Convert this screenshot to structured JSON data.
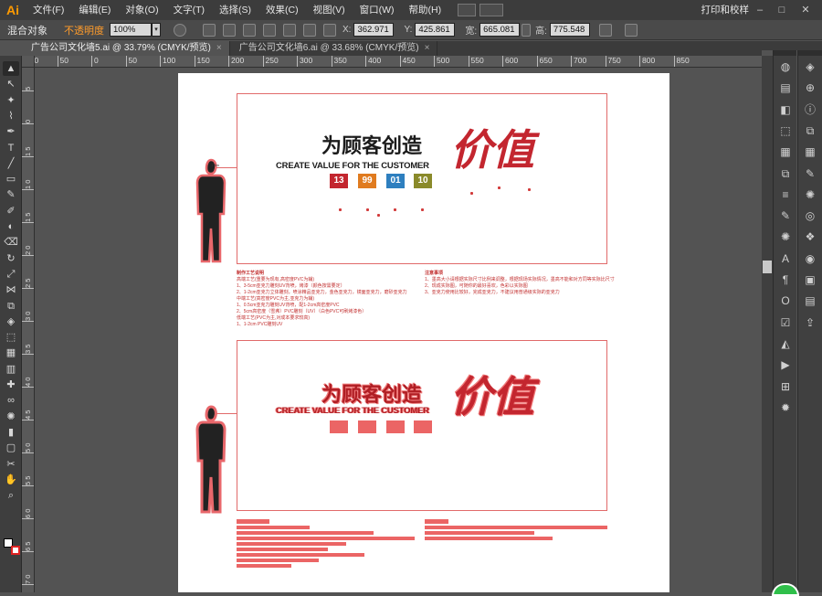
{
  "app": {
    "logo": "Ai"
  },
  "menu": [
    "文件(F)",
    "编辑(E)",
    "对象(O)",
    "文字(T)",
    "选择(S)",
    "效果(C)",
    "视图(V)",
    "窗口(W)",
    "帮助(H)"
  ],
  "workspace_label": "打印和校样",
  "control": {
    "mix_label": "混合对象",
    "opacity_label": "不透明度",
    "opacity_value": "100%",
    "x_label": "X:",
    "x_value": "362.971",
    "y_label": "Y:",
    "y_value": "425.861",
    "w_label": "宽:",
    "w_value": "665.081",
    "h_label": "高:",
    "h_value": "775.548"
  },
  "tabs": [
    {
      "label": "广告公司文化墙5.ai @ 33.79% (CMYK/预览)",
      "active": true
    },
    {
      "label": "广告公司文化墙6.ai @ 33.68% (CMYK/预览)",
      "active": false
    }
  ],
  "ruler_h": [
    "200",
    "150",
    "100",
    "50",
    "0",
    "50",
    "100",
    "150",
    "200",
    "250",
    "300",
    "350",
    "400",
    "450",
    "500",
    "550",
    "600",
    "650",
    "700",
    "750",
    "800",
    "850"
  ],
  "ruler_v": [
    "5",
    "0",
    "1 5",
    "1 0",
    "1 5",
    "2 0",
    "2 5",
    "3 0",
    "3 5",
    "4 0",
    "4 5",
    "5 0",
    "5 5",
    "6 0",
    "6 5",
    "7 0",
    "7 5"
  ],
  "art": {
    "headline": "为顾客创造",
    "big_word": "价值",
    "subline": "CREATE VALUE FOR THE CUSTOMER",
    "badges": [
      "13",
      "99",
      "01",
      "10"
    ],
    "badge_colors": [
      "#c3262f",
      "#e07b1f",
      "#2e7fbf",
      "#8a8a2a"
    ],
    "tiny_label": "1.8m",
    "spec_left_title": "制作工艺说明",
    "spec_left_lines": [
      "高端工艺(重要为现有,高密度PVC为辅)",
      "1、3-5cm亚克力雕刻UV背喷，烤漆（颜色按需要定）",
      "2、1-2cm亚克力立体雕刻，喷涂精品亚克力，金色亚克力，镜面亚克力，磨砂亚克力",
      "中端工艺(高密度PVC为主,亚克力为辅)",
      "1、0.5cm亚克力雕刻UV背喷，配1-2cm高密度PVC",
      "2、5cm高密度（雪弗）PVC雕刻（UV）（白色PVC可刷烤漆色）",
      "低端工艺(PVC为主,对成本要求较高)",
      "1、1-2cm PVC雕刻UV"
    ],
    "spec_right_title": "注意事项",
    "spec_right_lines": [
      "1、墨高大小请根据实际尺寸比例来调整，根据现场实际情况，墨高不能和对方同等实际比尺寸",
      "2、现成实际图，可随你的最好喜欢，色彩以实际图",
      "3、亚克力使用比较好，完成亚克力，不建议用普通级实际的亚克力"
    ]
  },
  "toolbox": [
    "selection-tool",
    "direct-selection-tool",
    "magic-wand-tool",
    "lasso-tool",
    "pen-tool",
    "type-tool",
    "line-tool",
    "rectangle-tool",
    "paintbrush-tool",
    "pencil-tool",
    "blob-brush-tool",
    "eraser-tool",
    "rotate-tool",
    "scale-tool",
    "width-tool",
    "free-transform-tool",
    "shape-builder-tool",
    "perspective-tool",
    "mesh-tool",
    "gradient-tool",
    "eyedropper-tool",
    "blend-tool",
    "symbol-sprayer-tool",
    "column-graph-tool",
    "artboard-tool",
    "slice-tool",
    "hand-tool",
    "zoom-tool"
  ]
}
